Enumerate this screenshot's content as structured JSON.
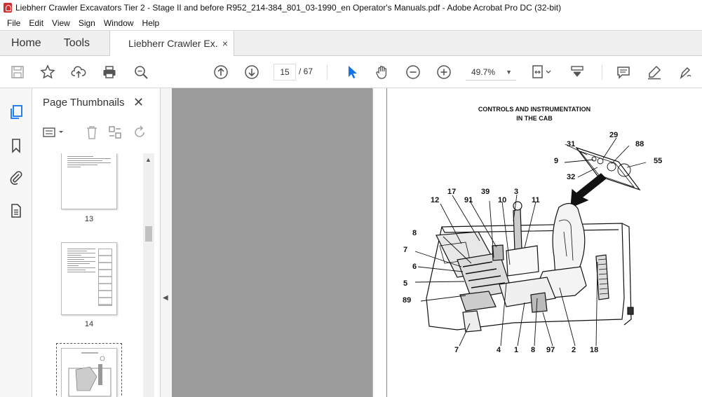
{
  "window": {
    "title": "Liebherr Crawler Excavators Tier 2 - Stage II and before  R952_214-384_801_03-1990_en Operator's Manuals.pdf - Adobe Acrobat Pro DC (32-bit)"
  },
  "menu": {
    "file": "File",
    "edit": "Edit",
    "view": "View",
    "sign": "Sign",
    "window": "Window",
    "help": "Help"
  },
  "tabs": {
    "home": "Home",
    "tools": "Tools",
    "document": "Liebherr Crawler Ex...",
    "close": "×"
  },
  "toolbar": {
    "current_page": "15",
    "total_pages": "/ 67",
    "zoom": "49.7%",
    "zoom_dd": "▼"
  },
  "thumbnails": {
    "title": "Page Thumbnails",
    "close": "✕",
    "pages": [
      {
        "label": "13"
      },
      {
        "label": "14"
      }
    ]
  },
  "document_page": {
    "heading_line1": "CONTROLS AND INSTRUMENTATION",
    "heading_line2": "IN THE CAB",
    "callouts": {
      "c31": "31",
      "c29": "29",
      "c88": "88",
      "c9": "9",
      "c55": "55",
      "c32": "32",
      "c17": "17",
      "c39": "39",
      "c3": "3",
      "c12": "12",
      "c91": "91",
      "c10": "10",
      "c11": "11",
      "c8a": "8",
      "c7a": "7",
      "c6": "6",
      "c5": "5",
      "c89": "89",
      "c7b": "7",
      "c4": "4",
      "c1": "1",
      "c8b": "8",
      "c97": "97",
      "c2": "2",
      "c18": "18"
    }
  },
  "colors": {
    "accent": "#1473e6",
    "pdf_red": "#d32f2f",
    "viewer_gray": "#9b9b9b"
  }
}
